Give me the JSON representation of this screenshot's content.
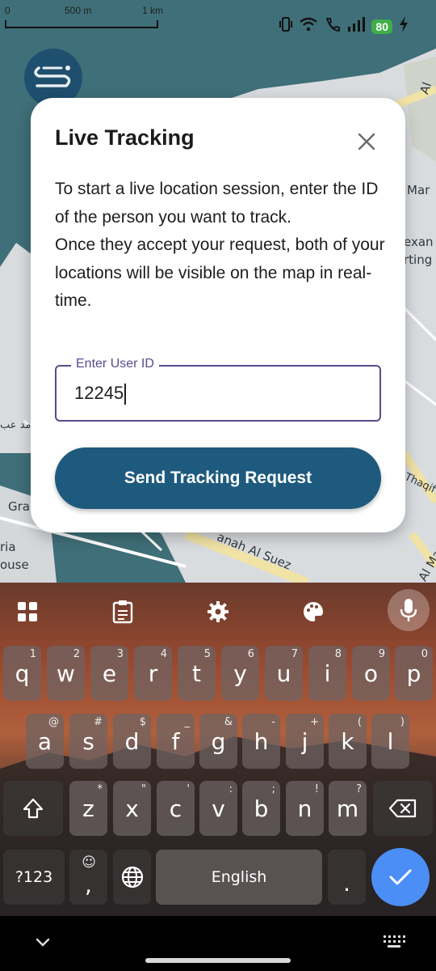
{
  "status_bar": {
    "scale_zero": "0",
    "scale_mid": "500 m",
    "scale_end": "1 km",
    "battery": "80"
  },
  "map": {
    "labels": [
      "Al",
      "Mar",
      "exan",
      "rting",
      "Thaqif",
      "Gra",
      "ria",
      "ouse",
      "anah Al Suez",
      "Al Ma",
      "مد عب"
    ]
  },
  "dialog": {
    "title": "Live Tracking",
    "body_line1": "To start a live location session, enter the ID of the person you want to track.",
    "body_line2": "Once they accept your request, both of your locations will be visible on the map in real-time.",
    "input_label": "Enter User ID",
    "input_value": "12245",
    "send_button": "Send Tracking Request"
  },
  "keyboard": {
    "row1": [
      {
        "key": "q",
        "hint": "1"
      },
      {
        "key": "w",
        "hint": "2"
      },
      {
        "key": "e",
        "hint": "3"
      },
      {
        "key": "r",
        "hint": "4"
      },
      {
        "key": "t",
        "hint": "5"
      },
      {
        "key": "y",
        "hint": "6"
      },
      {
        "key": "u",
        "hint": "7"
      },
      {
        "key": "i",
        "hint": "8"
      },
      {
        "key": "o",
        "hint": "9"
      },
      {
        "key": "p",
        "hint": "0"
      }
    ],
    "row2": [
      {
        "key": "a",
        "hint": "@"
      },
      {
        "key": "s",
        "hint": "#"
      },
      {
        "key": "d",
        "hint": "$"
      },
      {
        "key": "f",
        "hint": "_"
      },
      {
        "key": "g",
        "hint": "&"
      },
      {
        "key": "h",
        "hint": "-"
      },
      {
        "key": "j",
        "hint": "+"
      },
      {
        "key": "k",
        "hint": "("
      },
      {
        "key": "l",
        "hint": ")"
      }
    ],
    "row3": [
      {
        "key": "z",
        "hint": "*"
      },
      {
        "key": "x",
        "hint": "\""
      },
      {
        "key": "c",
        "hint": "'"
      },
      {
        "key": "v",
        "hint": ":"
      },
      {
        "key": "b",
        "hint": ";"
      },
      {
        "key": "n",
        "hint": "!"
      },
      {
        "key": "m",
        "hint": "?"
      }
    ],
    "symbols_key": "?123",
    "comma_key": ",",
    "emoji_hint": "☺",
    "space_label": "English",
    "period_key": "."
  }
}
